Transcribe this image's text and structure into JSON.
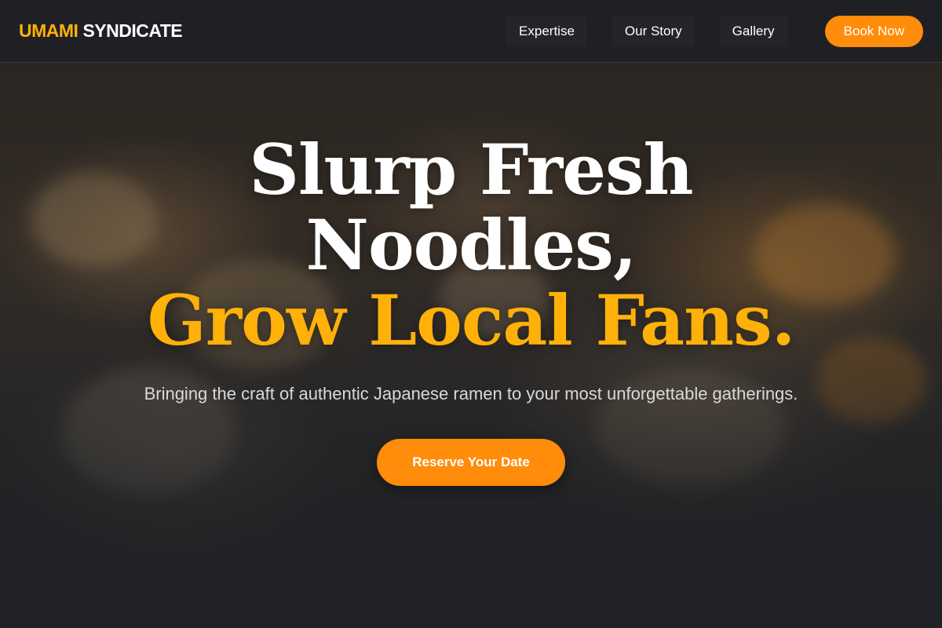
{
  "brand": {
    "accent": "UMAMI",
    "name": "SYNDICATE"
  },
  "nav": {
    "items": [
      {
        "label": "Expertise"
      },
      {
        "label": "Our Story"
      },
      {
        "label": "Gallery"
      }
    ],
    "cta_label": "Book Now"
  },
  "hero": {
    "headline_line1": "Slurp Fresh",
    "headline_line2": "Noodles,",
    "headline_accent": "Grow Local Fans.",
    "subtitle": "Bringing the craft of authentic Japanese ramen to your most unforgettable gatherings.",
    "cta_label": "Reserve Your Date"
  },
  "colors": {
    "accent": "#ffb10a",
    "button": "#ff8c0a",
    "background": "#1f2226"
  }
}
